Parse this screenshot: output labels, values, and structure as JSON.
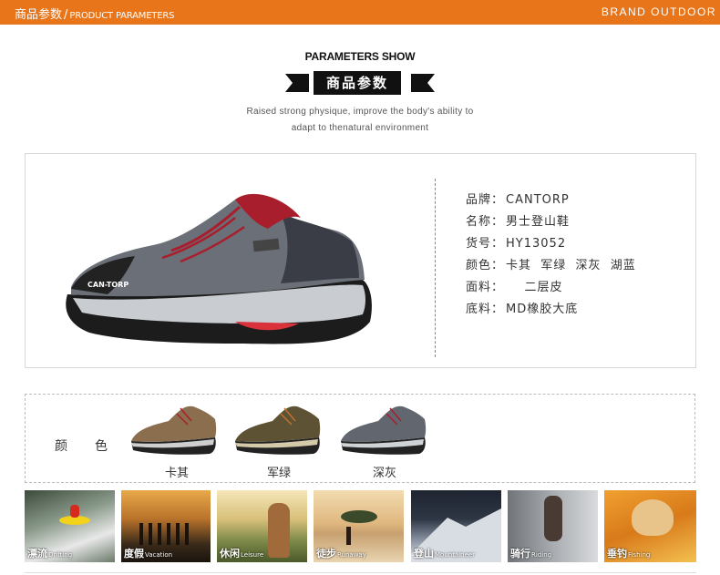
{
  "header": {
    "title_cn": "商品参数",
    "separator": "/",
    "title_en": "PRODUCT PARAMETERS",
    "brand": "BRAND OUTDOOR"
  },
  "section": {
    "title": "PARAMETERS SHOW",
    "title_cn": "商品参数",
    "subtitle_line1": "Raised strong physique, improve the body's ability to",
    "subtitle_line2": "adapt to thenatural environment"
  },
  "specs": [
    {
      "label": "品牌：",
      "value": "CANTORP"
    },
    {
      "label": "名称：",
      "value": "男士登山鞋"
    },
    {
      "label": "货号：",
      "value": "HY13052"
    },
    {
      "label": "颜色：",
      "value": "卡其  军绿  深灰  湖蓝"
    },
    {
      "label": "面料：",
      "value": "    二层皮"
    },
    {
      "label": "底料：",
      "value": "MD橡胶大底"
    }
  ],
  "colors": {
    "label": "颜色",
    "items": [
      {
        "name": "卡其"
      },
      {
        "name": "军绿"
      },
      {
        "name": "深灰"
      }
    ]
  },
  "shoe_logo": "CAN-TORP",
  "activities": [
    {
      "cn": "漂流",
      "en": "Drifting"
    },
    {
      "cn": "度假",
      "en": "Vacation"
    },
    {
      "cn": "休闲",
      "en": "Leisure"
    },
    {
      "cn": "徒步",
      "en": "Runaway"
    },
    {
      "cn": "登山",
      "en": "Mountaineer"
    },
    {
      "cn": "骑行",
      "en": "Riding"
    },
    {
      "cn": "垂钓",
      "en": "Fishing"
    }
  ],
  "theme": {
    "accent": "#e8751a"
  }
}
